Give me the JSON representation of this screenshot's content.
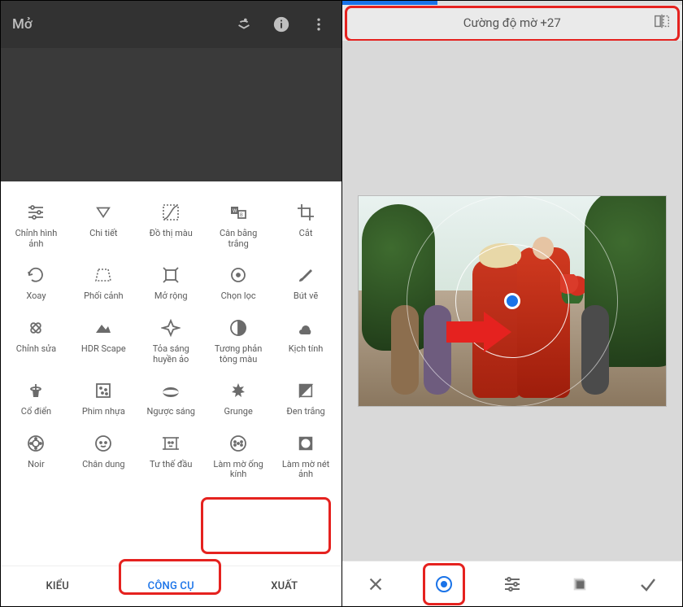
{
  "left": {
    "title": "Mở",
    "tools": [
      {
        "label": "Chỉnh hình ảnh",
        "icon": "tune"
      },
      {
        "label": "Chi tiết",
        "icon": "triangle-down"
      },
      {
        "label": "Đồ thị màu",
        "icon": "curve"
      },
      {
        "label": "Cân bằng trắng",
        "icon": "wb"
      },
      {
        "label": "Cắt",
        "icon": "crop"
      },
      {
        "label": "Xoay",
        "icon": "rotate"
      },
      {
        "label": "Phối cảnh",
        "icon": "perspective"
      },
      {
        "label": "Mở rộng",
        "icon": "expand"
      },
      {
        "label": "Chọn lọc",
        "icon": "target"
      },
      {
        "label": "Bút vẽ",
        "icon": "brush"
      },
      {
        "label": "Chỉnh sửa",
        "icon": "heal"
      },
      {
        "label": "HDR Scape",
        "icon": "hdr"
      },
      {
        "label": "Tỏa sáng huyền ảo",
        "icon": "glamour"
      },
      {
        "label": "Tương phản tông màu",
        "icon": "contrast"
      },
      {
        "label": "Kịch tính",
        "icon": "drama"
      },
      {
        "label": "Cổ điển",
        "icon": "vintage"
      },
      {
        "label": "Phim nhựa",
        "icon": "grainy"
      },
      {
        "label": "Ngược sáng",
        "icon": "retrolux"
      },
      {
        "label": "Grunge",
        "icon": "grunge"
      },
      {
        "label": "Đen trắng",
        "icon": "bw"
      },
      {
        "label": "Noir",
        "icon": "noir"
      },
      {
        "label": "Chân dung",
        "icon": "portrait"
      },
      {
        "label": "Tư thế đầu",
        "icon": "headpose"
      },
      {
        "label": "Làm mờ ống kính",
        "icon": "lensblur"
      },
      {
        "label": "Làm mờ nét ảnh",
        "icon": "vignette"
      }
    ],
    "tabs": {
      "styles": "KIỂU",
      "tools": "CÔNG CỤ",
      "export": "XUẤT"
    }
  },
  "right": {
    "progress_pct": 28,
    "slider_label": "Cường độ mờ +27"
  }
}
